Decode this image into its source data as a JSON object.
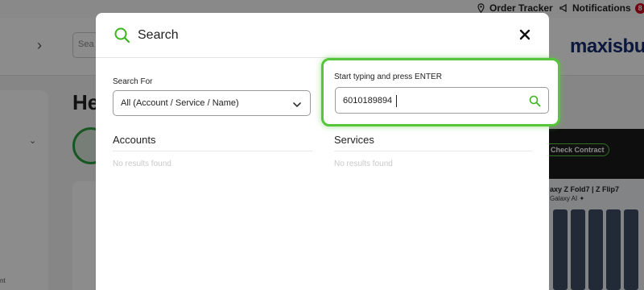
{
  "background": {
    "topbar": {
      "order_tracker_label": "Order Tracker",
      "notifications_label": "Notifications",
      "notifications_count": "8"
    },
    "header": {
      "search_placeholder": "Sea",
      "logo_text": "maxisbu"
    },
    "greeting": "He",
    "sidebar_text": "nt",
    "promo": {
      "check_contract_label": "Check Contract",
      "phone_title": "axy Z Fold7 | Z Flip7",
      "phone_sub": "Galaxy AI ✦"
    }
  },
  "modal": {
    "title": "Search",
    "search_for": {
      "label": "Search For",
      "selected": "All (Account / Service / Name)"
    },
    "query": {
      "label": "Start typing and press ENTER",
      "value": "6010189894"
    },
    "accounts": {
      "title": "Accounts",
      "empty_text": "No results found"
    },
    "services": {
      "title": "Services",
      "empty_text": "No results found"
    }
  },
  "colors": {
    "accent_green": "#55c63a",
    "brand_navy": "#142b6f",
    "badge_red": "#d0021b"
  },
  "icons": {
    "modal_title_icon": "search-icon",
    "close": "close-icon",
    "select_arrow": "chevron-down-icon",
    "input_submit": "search-icon"
  }
}
